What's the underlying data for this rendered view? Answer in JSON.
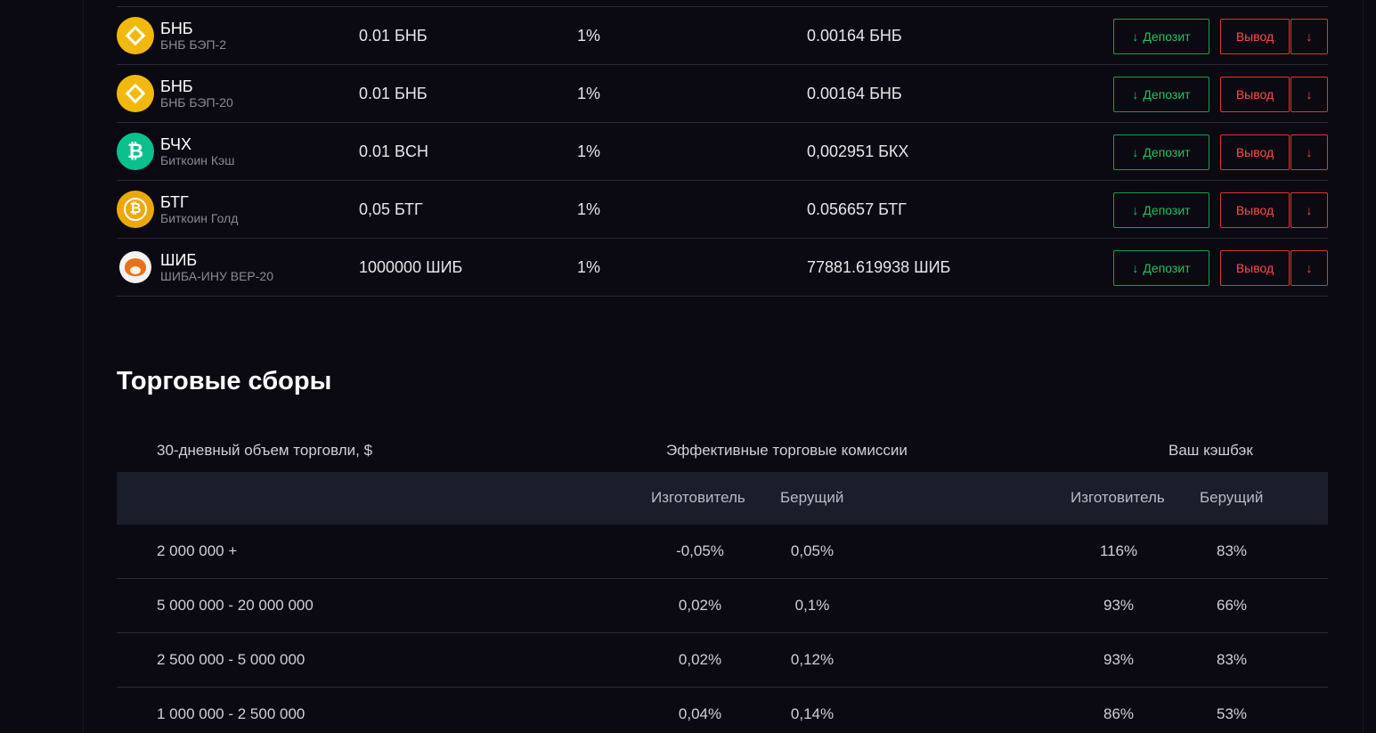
{
  "coins": [
    {
      "name": "БНБ",
      "network": "БНБ БЭП-2",
      "min": "0.01 БНБ",
      "fee": "1%",
      "fixed": "0.00164 БНБ",
      "icon": "bnb-icon"
    },
    {
      "name": "БНБ",
      "network": "БНБ БЭП-20",
      "min": "0.01 БНБ",
      "fee": "1%",
      "fixed": "0.00164 БНБ",
      "icon": "bnb-icon"
    },
    {
      "name": "БЧХ",
      "network": "Биткоин Кэш",
      "min": "0.01 BCH",
      "fee": "1%",
      "fixed": "0,002951 БКХ",
      "icon": "bitcoin-cash-icon"
    },
    {
      "name": "БТГ",
      "network": "Биткоин Голд",
      "min": "0,05 БТГ",
      "fee": "1%",
      "fixed": "0.056657 БТГ",
      "icon": "bitcoin-gold-icon"
    },
    {
      "name": "ШИБ",
      "network": "ШИБА-ИНУ BEP-20",
      "min": "1000000 ШИБ",
      "fee": "1%",
      "fixed": "77881.619938 ШИБ",
      "icon": "shiba-inu-icon"
    }
  ],
  "buttons": {
    "deposit_label": "Депозит",
    "deposit_arrow": "↓",
    "withdraw_label": "Вывод",
    "more_arrow": "↓"
  },
  "fees": {
    "title": "Торговые сборы",
    "head": {
      "volume": "30-дневный объем торговли, $",
      "commissions": "Эффективные торговые комиссии",
      "cashback": "Ваш кэшбэк"
    },
    "subhead": {
      "maker": "Изготовитель",
      "taker": "Берущий",
      "cb_maker": "Изготовитель",
      "cb_taker": "Берущий"
    },
    "rows": [
      {
        "volume": "2 000 000 +",
        "maker": "-0,05%",
        "taker": "0,05%",
        "cb_maker": "116%",
        "cb_taker": "83%"
      },
      {
        "volume": "5 000 000 - 20 000 000",
        "maker": "0,02%",
        "taker": "0,1%",
        "cb_maker": "93%",
        "cb_taker": "66%"
      },
      {
        "volume": "2 500 000 - 5 000 000",
        "maker": "0,02%",
        "taker": "0,12%",
        "cb_maker": "93%",
        "cb_taker": "83%"
      },
      {
        "volume": "1 000 000 - 2 500 000",
        "maker": "0,04%",
        "taker": "0,14%",
        "cb_maker": "86%",
        "cb_taker": "53%"
      }
    ]
  },
  "colors": {
    "background": "#0b0a12",
    "deposit": "#21c25e",
    "withdraw": "#ff4a4a",
    "bnb": "#f0b90b",
    "bch": "#0ac18e",
    "btg": "#eba809",
    "table_header": "#1a1e2b"
  }
}
